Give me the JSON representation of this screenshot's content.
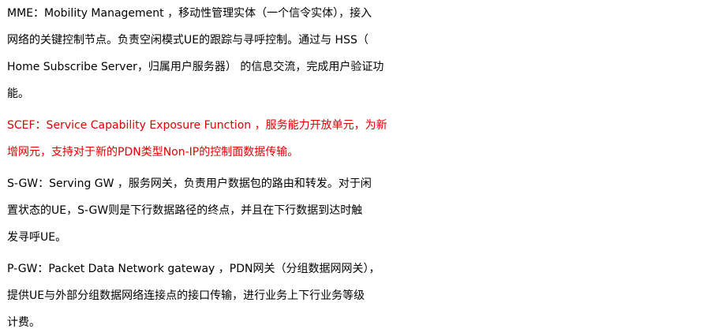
{
  "paragraphs": [
    {
      "id": "mme",
      "color": "#000000",
      "lines": [
        "MME：Mobility Management ，移动性管理实体（一个信令实体），接入",
        "网络的关键控制节点。负责空闲模式UE的跟踪与寻呼控制。通过与 HSS（",
        "Home Subscribe Server，归属用户服务器） 的信息交流，完成用户验证功",
        "能。"
      ]
    },
    {
      "id": "scef",
      "color": "#e00000",
      "lines": [
        "SCEF：Service Capability Exposure Function ，服务能力开放单元，为新",
        "增网元，支持对于新的PDN类型Non-IP的控制面数据传输。"
      ]
    },
    {
      "id": "sgw",
      "color": "#000000",
      "lines": [
        "S-GW：Serving GW ，服务网关，负责用户数据包的路由和转发。对于闲",
        "置状态的UE，S-GW则是下行数据路径的终点，并且在下行数据到达时触",
        "发寻呼UE。"
      ]
    },
    {
      "id": "pgw",
      "color": "#000000",
      "lines": [
        "P-GW：Packet Data Network gateway ，PDN网关（分组数据网网关），",
        "提供UE与外部分组数据网络连接点的接口传输，进行业务上下行业务等级",
        "计费。"
      ]
    }
  ]
}
